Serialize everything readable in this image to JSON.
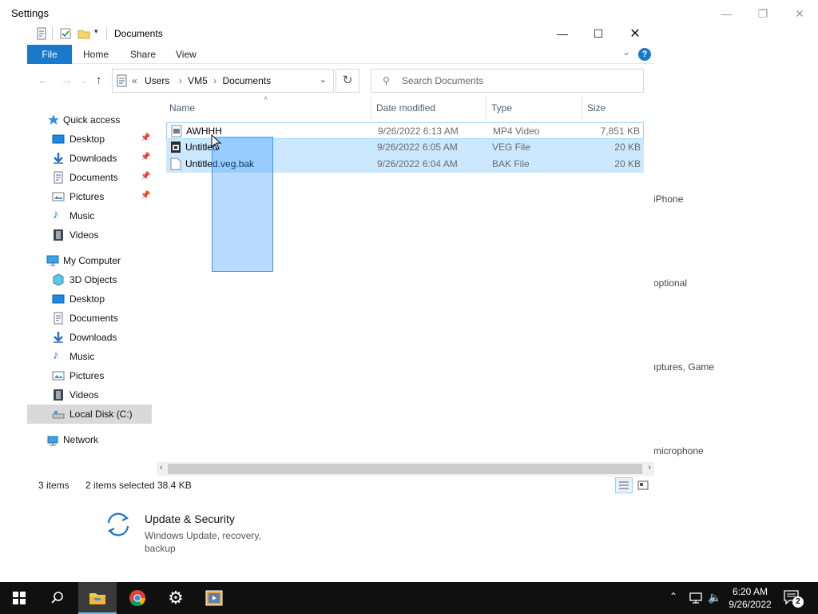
{
  "settings": {
    "title": "Settings",
    "fragments": [
      "iPhone",
      "optional",
      "ıptures, Game",
      "microphone"
    ],
    "update_security": {
      "title": "Update & Security",
      "desc": "Windows Update, recovery, backup"
    }
  },
  "explorer": {
    "title": "Documents",
    "ribbon_tabs": [
      "File",
      "Home",
      "Share",
      "View"
    ],
    "help": "?",
    "address": {
      "prefix": "«",
      "crumbs": [
        "Users",
        "VM5",
        "Documents"
      ]
    },
    "search_placeholder": "Search Documents",
    "nav": {
      "quick_access": "Quick access",
      "quick_items": [
        "Desktop",
        "Downloads",
        "Documents",
        "Pictures",
        "Music",
        "Videos"
      ],
      "my_computer": "My Computer",
      "computer_items": [
        "3D Objects",
        "Desktop",
        "Documents",
        "Downloads",
        "Music",
        "Pictures",
        "Videos",
        "Local Disk (C:)"
      ],
      "network": "Network"
    },
    "columns": [
      "Name",
      "Date modified",
      "Type",
      "Size"
    ],
    "files": [
      {
        "name": "AWHHH",
        "date": "9/26/2022 6:13 AM",
        "type": "MP4 Video",
        "size": "7,851 KB"
      },
      {
        "name": "Untitled",
        "date": "9/26/2022 6:05 AM",
        "type": "VEG File",
        "size": "20 KB"
      },
      {
        "name": "Untitled.veg.bak",
        "date": "9/26/2022 6:04 AM",
        "type": "BAK File",
        "size": "20 KB"
      }
    ],
    "status": {
      "items": "3 items",
      "selected": "2 items selected",
      "size": "38.4 KB"
    }
  },
  "taskbar": {
    "time": "6:20 AM",
    "date": "9/26/2022",
    "notification_count": "2",
    "apps": [
      "file-explorer",
      "chrome",
      "settings",
      "media-app"
    ]
  },
  "colors": {
    "accent": "#1979ca",
    "selection": "#cce8ff",
    "taskbar": "#101010"
  }
}
